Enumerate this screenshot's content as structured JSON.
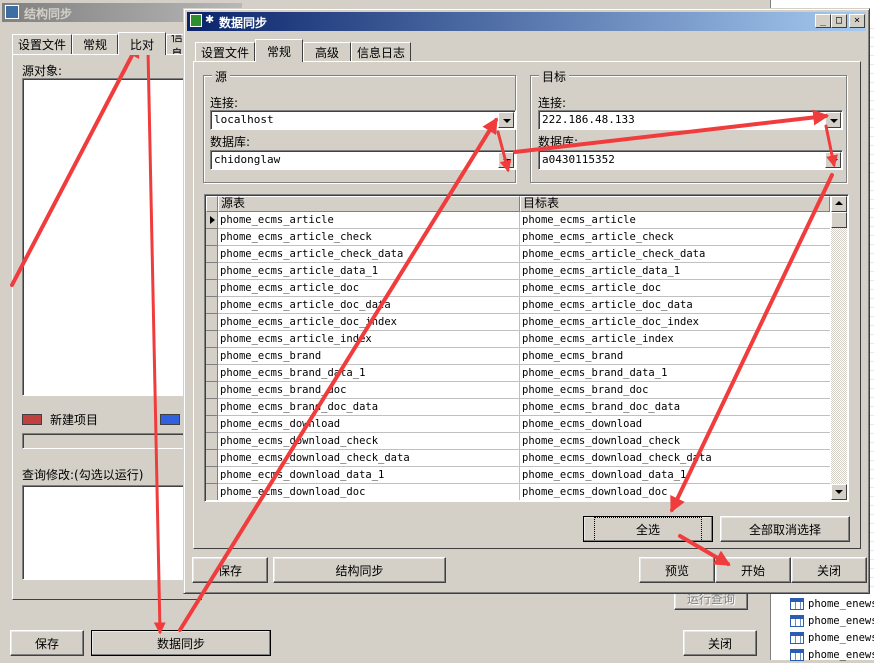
{
  "bg_window": {
    "title": "结构同步",
    "tabs": [
      "设置文件",
      "常规",
      "比对",
      "信息"
    ],
    "source_objects_label": "源对象:",
    "legend_new_item": "新建项目",
    "query_modify_label": "查询修改:(勾选以运行)",
    "run_query_button": "运行查询",
    "save_button": "保存",
    "data_sync_button": "数据同步",
    "close_button": "关闭",
    "legend_colors": {
      "new_item": "#c04040",
      "other": "#3060e0"
    }
  },
  "side_list": {
    "items": [
      "phome_enews",
      "phome_enews",
      "phome_enews",
      "phome_enews"
    ]
  },
  "dialog": {
    "title": "数据同步",
    "title_buttons": {
      "minimize": "_",
      "maximize": "□",
      "close": "×"
    },
    "tabs": [
      "设置文件",
      "常规",
      "高级",
      "信息日志"
    ],
    "source": {
      "group_title": "源",
      "connection_label": "连接:",
      "connection_value": "localhost",
      "database_label": "数据库:",
      "database_value": "chidonglaw"
    },
    "target": {
      "group_title": "目标",
      "connection_label": "连接:",
      "connection_value": "222.186.48.133",
      "database_label": "数据库:",
      "database_value": "a0430115352"
    },
    "grid": {
      "col_source": "源表",
      "col_target": "目标表",
      "rows": [
        [
          "phome_ecms_article",
          "phome_ecms_article"
        ],
        [
          "phome_ecms_article_check",
          "phome_ecms_article_check"
        ],
        [
          "phome_ecms_article_check_data",
          "phome_ecms_article_check_data"
        ],
        [
          "phome_ecms_article_data_1",
          "phome_ecms_article_data_1"
        ],
        [
          "phome_ecms_article_doc",
          "phome_ecms_article_doc"
        ],
        [
          "phome_ecms_article_doc_data",
          "phome_ecms_article_doc_data"
        ],
        [
          "phome_ecms_article_doc_index",
          "phome_ecms_article_doc_index"
        ],
        [
          "phome_ecms_article_index",
          "phome_ecms_article_index"
        ],
        [
          "phome_ecms_brand",
          "phome_ecms_brand"
        ],
        [
          "phome_ecms_brand_data_1",
          "phome_ecms_brand_data_1"
        ],
        [
          "phome_ecms_brand_doc",
          "phome_ecms_brand_doc"
        ],
        [
          "phome_ecms_brand_doc_data",
          "phome_ecms_brand_doc_data"
        ],
        [
          "phome_ecms_download",
          "phome_ecms_download"
        ],
        [
          "phome_ecms_download_check",
          "phome_ecms_download_check"
        ],
        [
          "phome_ecms_download_check_data",
          "phome_ecms_download_check_data"
        ],
        [
          "phome_ecms_download_data_1",
          "phome_ecms_download_data_1"
        ],
        [
          "phome_ecms_download_doc",
          "phome_ecms_download_doc"
        ]
      ]
    },
    "select_all_button": "全选",
    "deselect_all_button": "全部取消选择",
    "save_button": "保存",
    "structure_sync_button": "结构同步",
    "preview_button": "预览",
    "start_button": "开始",
    "close_button": "关闭"
  },
  "colors": {
    "title_active_start": "#0a246a",
    "title_active_end": "#a6caf0",
    "title_inactive": "#808080",
    "annotation_arrow": "#f03c3c"
  }
}
